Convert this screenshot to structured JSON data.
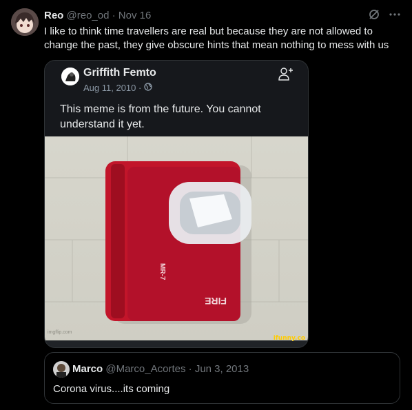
{
  "tweet": {
    "author_name": "Reo",
    "handle": "@reo_od",
    "separator": "·",
    "date": "Nov 16",
    "text": "I like to think time travellers are real but because they are not allowed to change the past, they give obscure hints that mean nothing to mess with us"
  },
  "embedded_post": {
    "author_name": "Griffith Femto",
    "date": "Aug 11, 2010 ·",
    "text": "This meme is from the future. You cannot understand it yet.",
    "image_labels": {
      "fire": "FIRE",
      "model": "MR-7",
      "watermark": "imgflip.com",
      "ifunny": "ifunny.co"
    }
  },
  "quoted_tweet": {
    "author_name": "Marco",
    "handle": "@Marco_Acortes",
    "separator": "·",
    "date": "Jun 3, 2013",
    "text": "Corona virus....its coming"
  },
  "icons": {
    "grok": "grok-icon",
    "more": "more-icon",
    "follow": "add-person-icon",
    "globe": "globe-icon"
  },
  "colors": {
    "background": "#000000",
    "muted_text": "#71767b",
    "card_bg": "#16181c",
    "alarm_red": "#c2152a"
  }
}
